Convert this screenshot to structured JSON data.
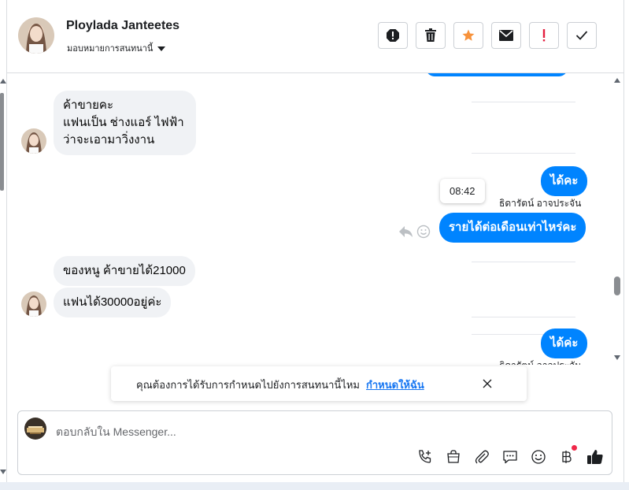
{
  "header": {
    "name": "Ploylada Janteetes",
    "subtitle": "มอบหมายการสนทนานี้",
    "actions": [
      "alert-icon",
      "trash-icon",
      "star-icon",
      "mail-icon",
      "flag-icon",
      "check-icon"
    ]
  },
  "messages": {
    "in1_line1": "ค้าขายคะ",
    "in1_line2": "แฟนเป็น ช่างแอร์  ไฟฟ้า",
    "in1_line3": "ว่าจะเอามาวิ่งงาน",
    "out1": "ได้คะ",
    "out1_sender": "ธิดารัตน์ อาจประจัน",
    "tooltip_time": "08:42",
    "out2": "รายได้ต่อเดือนเท่าไหร่คะ",
    "in2": "ของหนู ค้าขายได้21000",
    "in3": "แฟนได้30000อยู่ค่ะ",
    "out3": "ได้ค่ะ",
    "out3_sender": "ธิดารัตน์ อาจประจัน"
  },
  "banner": {
    "text": "คุณต้องการได้รับการกำหนดไปยังการสนทนานี้ไหม",
    "link": "กำหนดให้ฉัน"
  },
  "composer": {
    "placeholder": "ตอบกลับใน Messenger...",
    "icons": [
      "call-add-icon",
      "shop-icon",
      "attach-icon",
      "saved-reply-icon",
      "emoji-icon",
      "baht-icon",
      "like-icon"
    ]
  },
  "colors": {
    "accent": "#0084ff",
    "star": "#f7923b",
    "flag": "#e41e3f"
  }
}
